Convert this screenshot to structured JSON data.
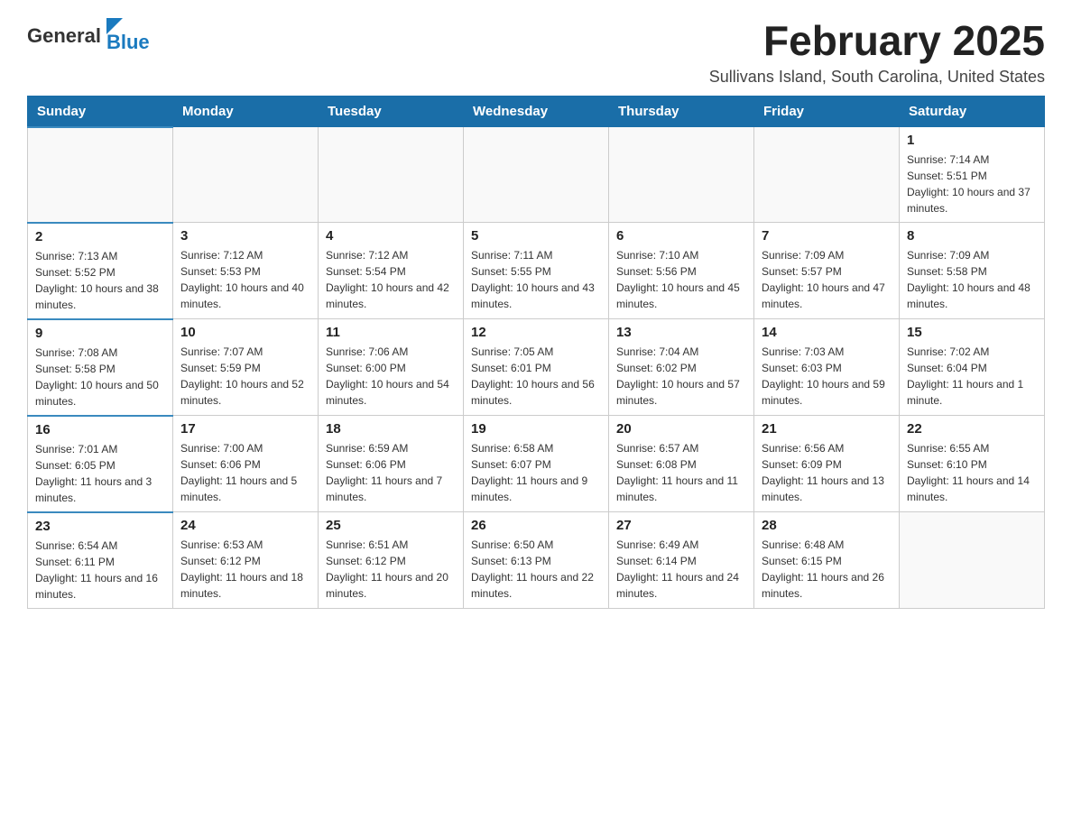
{
  "header": {
    "logo": {
      "general": "General",
      "blue": "Blue"
    },
    "title": "February 2025",
    "location": "Sullivans Island, South Carolina, United States"
  },
  "weekdays": [
    "Sunday",
    "Monday",
    "Tuesday",
    "Wednesday",
    "Thursday",
    "Friday",
    "Saturday"
  ],
  "weeks": [
    [
      {
        "day": "",
        "info": ""
      },
      {
        "day": "",
        "info": ""
      },
      {
        "day": "",
        "info": ""
      },
      {
        "day": "",
        "info": ""
      },
      {
        "day": "",
        "info": ""
      },
      {
        "day": "",
        "info": ""
      },
      {
        "day": "1",
        "info": "Sunrise: 7:14 AM\nSunset: 5:51 PM\nDaylight: 10 hours and 37 minutes."
      }
    ],
    [
      {
        "day": "2",
        "info": "Sunrise: 7:13 AM\nSunset: 5:52 PM\nDaylight: 10 hours and 38 minutes."
      },
      {
        "day": "3",
        "info": "Sunrise: 7:12 AM\nSunset: 5:53 PM\nDaylight: 10 hours and 40 minutes."
      },
      {
        "day": "4",
        "info": "Sunrise: 7:12 AM\nSunset: 5:54 PM\nDaylight: 10 hours and 42 minutes."
      },
      {
        "day": "5",
        "info": "Sunrise: 7:11 AM\nSunset: 5:55 PM\nDaylight: 10 hours and 43 minutes."
      },
      {
        "day": "6",
        "info": "Sunrise: 7:10 AM\nSunset: 5:56 PM\nDaylight: 10 hours and 45 minutes."
      },
      {
        "day": "7",
        "info": "Sunrise: 7:09 AM\nSunset: 5:57 PM\nDaylight: 10 hours and 47 minutes."
      },
      {
        "day": "8",
        "info": "Sunrise: 7:09 AM\nSunset: 5:58 PM\nDaylight: 10 hours and 48 minutes."
      }
    ],
    [
      {
        "day": "9",
        "info": "Sunrise: 7:08 AM\nSunset: 5:58 PM\nDaylight: 10 hours and 50 minutes."
      },
      {
        "day": "10",
        "info": "Sunrise: 7:07 AM\nSunset: 5:59 PM\nDaylight: 10 hours and 52 minutes."
      },
      {
        "day": "11",
        "info": "Sunrise: 7:06 AM\nSunset: 6:00 PM\nDaylight: 10 hours and 54 minutes."
      },
      {
        "day": "12",
        "info": "Sunrise: 7:05 AM\nSunset: 6:01 PM\nDaylight: 10 hours and 56 minutes."
      },
      {
        "day": "13",
        "info": "Sunrise: 7:04 AM\nSunset: 6:02 PM\nDaylight: 10 hours and 57 minutes."
      },
      {
        "day": "14",
        "info": "Sunrise: 7:03 AM\nSunset: 6:03 PM\nDaylight: 10 hours and 59 minutes."
      },
      {
        "day": "15",
        "info": "Sunrise: 7:02 AM\nSunset: 6:04 PM\nDaylight: 11 hours and 1 minute."
      }
    ],
    [
      {
        "day": "16",
        "info": "Sunrise: 7:01 AM\nSunset: 6:05 PM\nDaylight: 11 hours and 3 minutes."
      },
      {
        "day": "17",
        "info": "Sunrise: 7:00 AM\nSunset: 6:06 PM\nDaylight: 11 hours and 5 minutes."
      },
      {
        "day": "18",
        "info": "Sunrise: 6:59 AM\nSunset: 6:06 PM\nDaylight: 11 hours and 7 minutes."
      },
      {
        "day": "19",
        "info": "Sunrise: 6:58 AM\nSunset: 6:07 PM\nDaylight: 11 hours and 9 minutes."
      },
      {
        "day": "20",
        "info": "Sunrise: 6:57 AM\nSunset: 6:08 PM\nDaylight: 11 hours and 11 minutes."
      },
      {
        "day": "21",
        "info": "Sunrise: 6:56 AM\nSunset: 6:09 PM\nDaylight: 11 hours and 13 minutes."
      },
      {
        "day": "22",
        "info": "Sunrise: 6:55 AM\nSunset: 6:10 PM\nDaylight: 11 hours and 14 minutes."
      }
    ],
    [
      {
        "day": "23",
        "info": "Sunrise: 6:54 AM\nSunset: 6:11 PM\nDaylight: 11 hours and 16 minutes."
      },
      {
        "day": "24",
        "info": "Sunrise: 6:53 AM\nSunset: 6:12 PM\nDaylight: 11 hours and 18 minutes."
      },
      {
        "day": "25",
        "info": "Sunrise: 6:51 AM\nSunset: 6:12 PM\nDaylight: 11 hours and 20 minutes."
      },
      {
        "day": "26",
        "info": "Sunrise: 6:50 AM\nSunset: 6:13 PM\nDaylight: 11 hours and 22 minutes."
      },
      {
        "day": "27",
        "info": "Sunrise: 6:49 AM\nSunset: 6:14 PM\nDaylight: 11 hours and 24 minutes."
      },
      {
        "day": "28",
        "info": "Sunrise: 6:48 AM\nSunset: 6:15 PM\nDaylight: 11 hours and 26 minutes."
      },
      {
        "day": "",
        "info": ""
      }
    ]
  ]
}
